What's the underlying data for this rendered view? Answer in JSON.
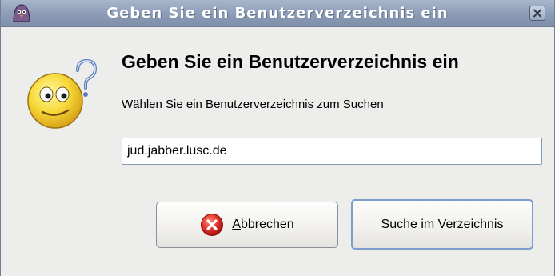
{
  "window": {
    "title": "Geben Sie ein Benutzerverzeichnis ein",
    "app_icon": "pidgin-icon",
    "close_icon": "close-icon"
  },
  "dialog": {
    "icon": "question-smiley-icon",
    "heading": "Geben Sie ein Benutzerverzeichnis ein",
    "description": "Wählen Sie ein Benutzerverzeichnis zum Suchen",
    "input_value": "jud.jabber.lusc.de"
  },
  "buttons": {
    "cancel": {
      "mnemonic": "A",
      "rest": "bbrechen",
      "icon": "cancel-icon"
    },
    "search": {
      "label": "Suche im Verzeichnis"
    }
  },
  "colors": {
    "titlebar": "#8c9cb7",
    "window_bg": "#ededeb",
    "cancel_icon": "#d62c26",
    "focus_border": "#7e9ccc"
  }
}
